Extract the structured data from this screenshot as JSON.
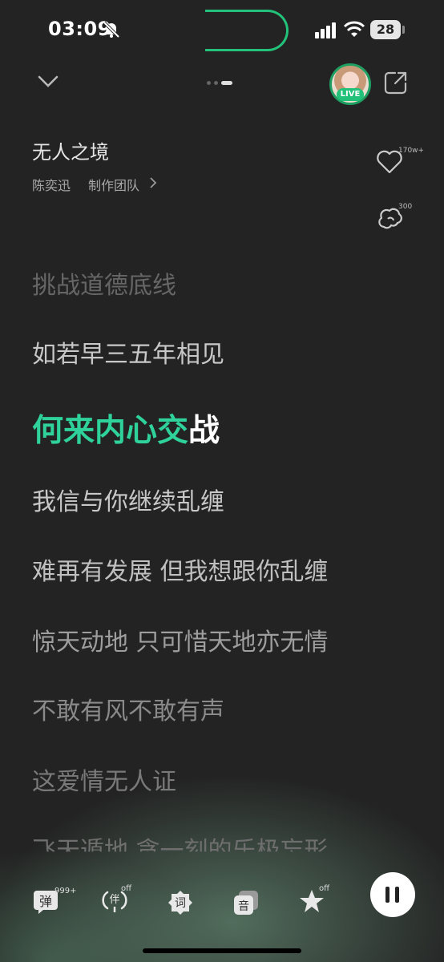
{
  "status": {
    "time": "03:09",
    "battery": "28"
  },
  "header": {
    "live_badge": "LIVE"
  },
  "song": {
    "title": "无人之境",
    "artist": "陈奕迅",
    "team": "制作团队"
  },
  "actions": {
    "like_count": "170w+",
    "comment_count": "300"
  },
  "lyrics": {
    "lines": [
      "挑战道德底线",
      "如若早三五年相见",
      "何来内心交战",
      "我信与你继续乱缠",
      "难再有发展 但我想跟你乱缠",
      "惊天动地 只可惜天地亦无情",
      "不敢有风不敢有声",
      "这爱情无人证",
      "飞天遁地 贪一刻的乐极忘形"
    ],
    "current_highlighted": "何来内心交",
    "current_rest": "战"
  },
  "bottom_bar": {
    "danmu_label": "弹",
    "danmu_count": "999+",
    "accompany_label": "伴",
    "accompany_state": "off",
    "lyrics_label": "词",
    "sound_label": "音",
    "effect_state": "off"
  },
  "colors": {
    "accent": "#2ed29a",
    "background": "#232323",
    "live_green": "#21c17a"
  }
}
